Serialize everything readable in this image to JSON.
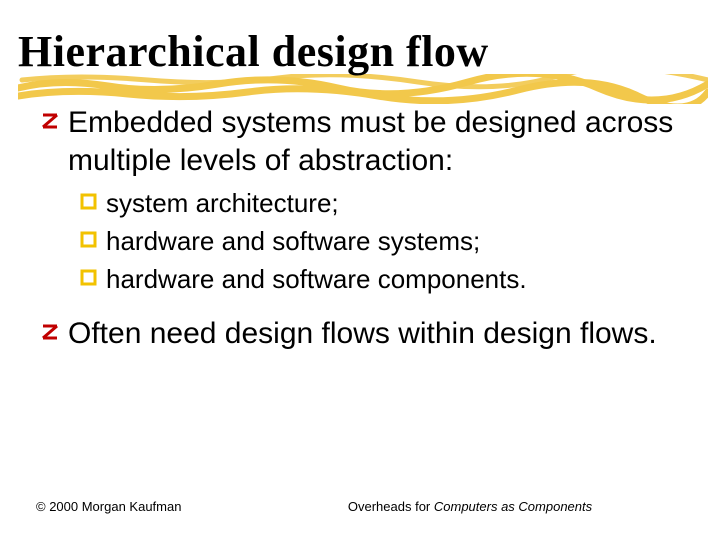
{
  "title": "Hierarchical design flow",
  "bullets": [
    {
      "text": "Embedded systems must be designed across multiple levels of abstraction:",
      "children": [
        {
          "text": "system architecture;"
        },
        {
          "text": "hardware and software systems;"
        },
        {
          "text": "hardware and software components."
        }
      ]
    },
    {
      "text": "Often need design flows within design flows.",
      "children": []
    }
  ],
  "footer": {
    "copyright": "© 2000 Morgan Kaufman",
    "center_prefix": "Overheads for ",
    "center_italic": "Computers as Components"
  },
  "colors": {
    "bullet_red": "#c00000",
    "bullet_yellow": "#f2c200",
    "underline": "#f2c84b"
  }
}
